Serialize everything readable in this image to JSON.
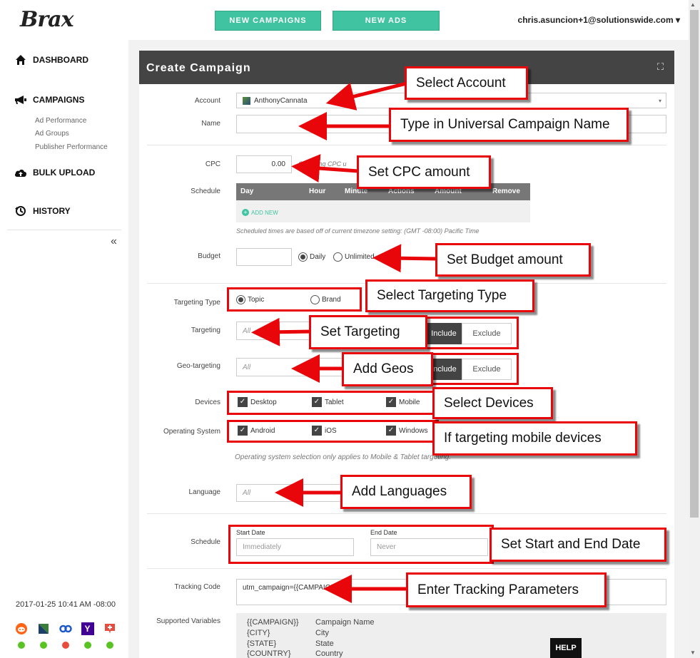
{
  "brand": "Brax",
  "topbar": {
    "new_campaigns": "NEW CAMPAIGNS",
    "new_ads": "NEW ADS",
    "user_email": "chris.asuncion+1@solutionswide.com",
    "user_caret": "▾"
  },
  "sidebar": {
    "dashboard": "DASHBOARD",
    "campaigns": "CAMPAIGNS",
    "sub_items": [
      "Ad Performance",
      "Ad Groups",
      "Publisher Performance"
    ],
    "bulk_upload": "BULK UPLOAD",
    "history": "HISTORY",
    "collapse": "«",
    "timestamp": "2017-01-25 10:41 AM -08:00",
    "publisher_status": [
      "#58c322",
      "#58c322",
      "#e84c3d",
      "#58c322",
      "#58c322"
    ]
  },
  "panel": {
    "title": "Create Campaign",
    "expand": "⛶"
  },
  "form": {
    "account_label": "Account",
    "account_value": "AnthonyCannata",
    "name_label": "Name",
    "cpc_label": "CPC",
    "cpc_value": "0.00",
    "cpc_note": "Changing CPC u",
    "schedule_label": "Schedule",
    "schedule_cols": [
      "Day",
      "Hour",
      "Minute",
      "Actions",
      "Amount",
      "Remove"
    ],
    "add_new": "ADD NEW",
    "schedule_note": "Scheduled times are based off of current timezone setting: (GMT -08:00) Pacific Time",
    "budget_label": "Budget",
    "budget_daily": "Daily",
    "budget_unlimited": "Unlimited",
    "targeting_type_label": "Targeting Type",
    "topic": "Topic",
    "brand": "Brand",
    "targeting_label": "Targeting",
    "targeting_placeholder": "All",
    "include": "Include",
    "exclude": "Exclude",
    "geo_label": "Geo-targeting",
    "geo_placeholder": "All",
    "devices_label": "Devices",
    "devices": [
      "Desktop",
      "Tablet",
      "Mobile"
    ],
    "os_label": "Operating System",
    "os": [
      "Android",
      "iOS",
      "Windows"
    ],
    "os_note": "Operating system selection only applies to Mobile & Tablet targeting.",
    "language_label": "Language",
    "language_placeholder": "All",
    "schedule2_label": "Schedule",
    "start_date_label": "Start Date",
    "start_date_placeholder": "Immediately",
    "end_date_label": "End Date",
    "end_date_placeholder": "Never",
    "tracking_label": "Tracking Code",
    "tracking_value": "utm_campaign={{CAMPAIGN",
    "supported_label": "Supported Variables",
    "variables": [
      {
        "key": "{{CAMPAIGN}}",
        "desc": "Campaign Name"
      },
      {
        "key": "{CITY}",
        "desc": "City"
      },
      {
        "key": "{STATE}",
        "desc": "State"
      },
      {
        "key": "{COUNTRY}",
        "desc": "Country"
      }
    ]
  },
  "callouts": {
    "select_account": "Select Account",
    "type_name": "Type in Universal Campaign Name",
    "set_cpc": "Set CPC amount",
    "set_budget": "Set Budget amount",
    "select_targeting_type": "Select Targeting Type",
    "set_targeting": "Set Targeting",
    "add_geos": "Add Geos",
    "select_devices": "Select Devices",
    "mobile_note": "If targeting mobile devices",
    "add_languages": "Add Languages",
    "set_dates": "Set Start and End Date",
    "tracking": "Enter Tracking Parameters"
  },
  "help": "HELP"
}
